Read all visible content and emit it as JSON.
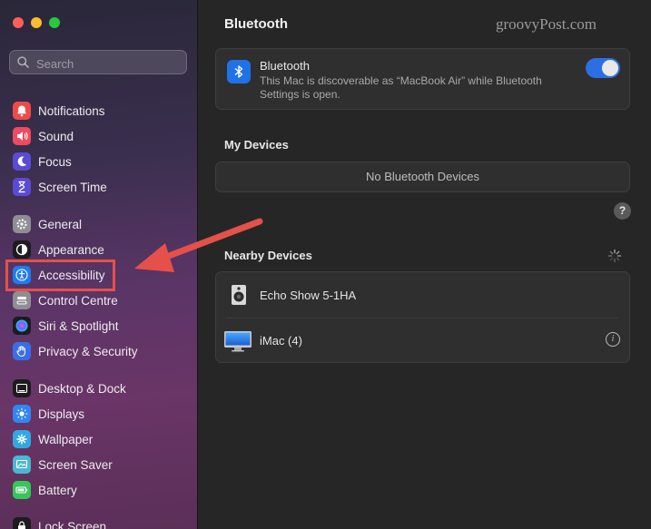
{
  "window": {
    "traffic_lights": [
      {
        "name": "close",
        "color": "#fe5f57"
      },
      {
        "name": "minimize",
        "color": "#febc2e"
      },
      {
        "name": "zoom",
        "color": "#28c840"
      }
    ]
  },
  "search": {
    "placeholder": "Search",
    "value": ""
  },
  "sidebar": {
    "items": [
      {
        "label": "Notifications",
        "icon": "bell-icon",
        "color": "#ef4a4a"
      },
      {
        "label": "Sound",
        "icon": "speaker-icon",
        "color": "#ef4a60"
      },
      {
        "label": "Focus",
        "icon": "moon-icon",
        "color": "#5a4bd6"
      },
      {
        "label": "Screen Time",
        "icon": "hourglass-icon",
        "color": "#5a4bd6"
      },
      {
        "label": "General",
        "icon": "gear-icon",
        "color": "#8e8e93"
      },
      {
        "label": "Appearance",
        "icon": "appearance-icon",
        "color": "#1c1c1e"
      },
      {
        "label": "Accessibility",
        "icon": "accessibility-icon",
        "color": "#1e7cf2"
      },
      {
        "label": "Control Centre",
        "icon": "control-centre-icon",
        "color": "#8e8e93"
      },
      {
        "label": "Siri & Spotlight",
        "icon": "siri-icon",
        "color": "#1c1c1e"
      },
      {
        "label": "Privacy & Security",
        "icon": "hand-icon",
        "color": "#3a6ee8"
      },
      {
        "label": "Desktop & Dock",
        "icon": "dock-icon",
        "color": "#1c1c1e"
      },
      {
        "label": "Displays",
        "icon": "sun-icon",
        "color": "#2f86f2"
      },
      {
        "label": "Wallpaper",
        "icon": "wallpaper-icon",
        "color": "#31a8e0"
      },
      {
        "label": "Screen Saver",
        "icon": "screen-saver-icon",
        "color": "#4bb7d4"
      },
      {
        "label": "Battery",
        "icon": "battery-icon",
        "color": "#34c759"
      },
      {
        "label": "Lock Screen",
        "icon": "lock-icon",
        "color": "#1c1c1e"
      }
    ]
  },
  "main": {
    "title": "Bluetooth",
    "watermark": "groovyPost.com",
    "bluetooth": {
      "title": "Bluetooth",
      "description": "This Mac is discoverable as “MacBook Air” while Bluetooth Settings is open.",
      "enabled": true,
      "accent": "#2b6fe0"
    },
    "my_devices": {
      "header": "My Devices",
      "empty": "No Bluetooth Devices"
    },
    "help_label": "?",
    "nearby": {
      "header": "Nearby Devices",
      "devices": [
        {
          "label": "Echo Show 5-1HA",
          "icon": "speaker-device-icon"
        },
        {
          "label": "iMac (4)",
          "icon": "imac-icon"
        }
      ]
    }
  },
  "annotation": {
    "color": "#e5504a"
  }
}
